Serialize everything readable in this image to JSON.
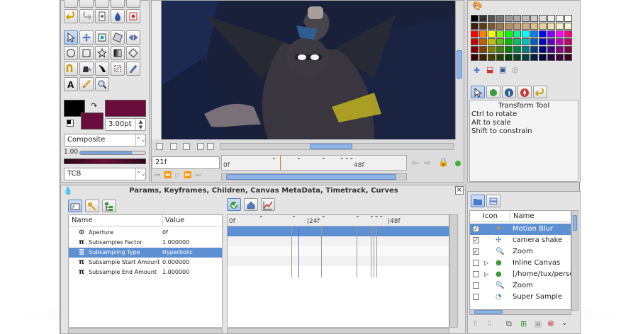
{
  "canvas": {
    "frame_field": "21f",
    "timebar_start": "0f",
    "timebar_mid": "48f"
  },
  "toolbox": {
    "outline_color": "#000000",
    "fill_color": "#6a0d3c",
    "width_value": "3.00pt",
    "blend_method": "Composite",
    "amount_value": "1.00",
    "interpolation": "TCB"
  },
  "params_panel": {
    "title": "Params, Keyframes, Children, Canvas MetaData, Timetrack, Curves",
    "col_name": "Name",
    "col_value": "Value",
    "rows": [
      {
        "name": "Aperture",
        "value": "0f",
        "icon": "aperture-icon"
      },
      {
        "name": "Subsamples Factor",
        "value": "1.000000",
        "icon": "pi-icon"
      },
      {
        "name": "Subsampling Type",
        "value": "Hyperbolic",
        "icon": "subsampling-icon"
      },
      {
        "name": "Subsample Start Amount",
        "value": "0.000000",
        "icon": "pi-icon"
      },
      {
        "name": "Subsample End Amount",
        "value": "1.000000",
        "icon": "pi-icon"
      }
    ]
  },
  "timetrack": {
    "label_start": "0f",
    "label_24": "|24f",
    "label_48": "|48f"
  },
  "tool_options": {
    "title": "Transform Tool",
    "lines": [
      "Ctrl to rotate",
      "Alt to scale",
      "Shift to constrain"
    ]
  },
  "layers": {
    "col_icon": "Icon",
    "col_name": "Name",
    "rows": [
      {
        "name": "Motion Blur",
        "checked": "✓",
        "expander": "",
        "icon": "motion-blur-icon"
      },
      {
        "name": "camera shake",
        "checked": "✓",
        "expander": "",
        "icon": "translate-icon"
      },
      {
        "name": "Zoom",
        "checked": "✓",
        "expander": "",
        "icon": "zoom-icon"
      },
      {
        "name": "Inline Canvas",
        "checked": "",
        "expander": "▷",
        "icon": "group-icon"
      },
      {
        "name": "[/home/tux/perso",
        "checked": "",
        "expander": "▷",
        "icon": "group-icon"
      },
      {
        "name": "Zoom",
        "checked": "",
        "expander": "",
        "icon": "zoom-icon"
      },
      {
        "name": "Super Sample",
        "checked": "",
        "expander": "",
        "icon": "super-sample-icon"
      }
    ]
  },
  "colors": {
    "selection": "#5d8fd3",
    "canvas_bg": "#1a2238"
  }
}
